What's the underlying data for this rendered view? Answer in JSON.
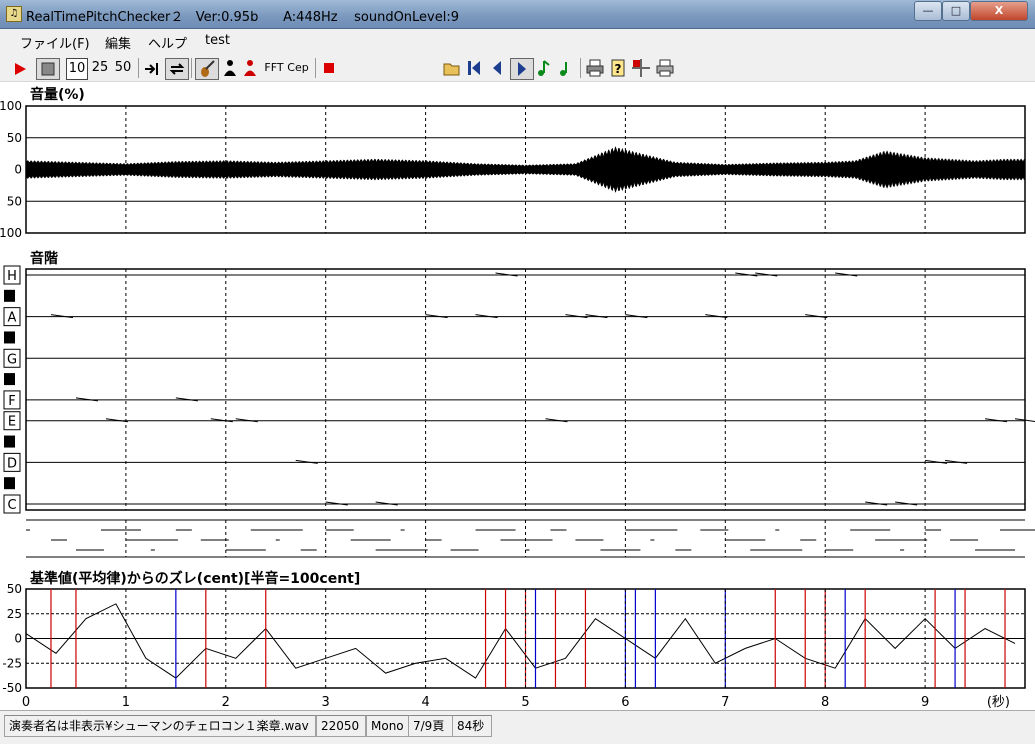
{
  "window": {
    "title": "RealTimePitchChecker２   Ver:0.95b      A:448Hz    soundOnLevel:9",
    "minimize_label": "—",
    "maximize_label": "□",
    "close_label": "X"
  },
  "menu": {
    "items": [
      "ファイル(F)",
      "編集",
      "ヘルプ",
      "test"
    ]
  },
  "toolbar": {
    "speed_options": [
      "10",
      "25",
      "50"
    ],
    "fft_label": "FFT",
    "cep_label": "Cep",
    "note_display": "＊＊＊"
  },
  "volume_panel": {
    "title": "音量(%)",
    "y_labels": [
      "100",
      "50",
      "0",
      "50",
      "100"
    ]
  },
  "scale_panel": {
    "title": "音階",
    "note_labels": [
      "H",
      "A",
      "G",
      "F",
      "E",
      "D",
      "C"
    ]
  },
  "deviation_panel": {
    "title": "基準値(平均律)からのズレ(cent)[半音=100cent]",
    "y_labels": [
      "50",
      "25",
      "0",
      "-25",
      "-50"
    ]
  },
  "time_axis": {
    "labels": [
      "0",
      "1",
      "2",
      "3",
      "4",
      "5",
      "6",
      "7",
      "8",
      "9"
    ],
    "unit": "(秒)"
  },
  "statusbar": {
    "file": "演奏者名は非表示¥シューマンのチェロコン１楽章.wav",
    "rate": "22050",
    "channels": "Mono",
    "page": "7/9頁",
    "duration": "84秒"
  },
  "chart_data": [
    {
      "type": "area",
      "title": "音量(%)",
      "x": [
        0,
        0.5,
        1,
        1.5,
        2,
        2.5,
        3,
        3.5,
        4,
        4.5,
        5,
        5.5,
        5.9,
        6.2,
        6.5,
        7,
        7.5,
        8,
        8.3,
        8.6,
        9,
        9.5,
        9.8
      ],
      "values": [
        12,
        10,
        8,
        11,
        12,
        10,
        12,
        14,
        12,
        8,
        6,
        8,
        30,
        20,
        10,
        7,
        9,
        10,
        12,
        25,
        16,
        12,
        14
      ],
      "xlim": [
        0,
        10
      ],
      "ylim": [
        -100,
        100
      ]
    },
    {
      "type": "line",
      "title": "音階",
      "y_categories": [
        "C",
        "D",
        "E",
        "F",
        "G",
        "A",
        "H"
      ],
      "x": [
        0.25,
        0.5,
        0.8,
        1.5,
        1.85,
        2.1,
        2.7,
        3.0,
        3.5,
        4.0,
        4.5,
        4.7,
        5.2,
        5.4,
        5.6,
        6.0,
        6.8,
        7.1,
        7.3,
        7.8,
        8.1,
        8.4,
        8.7,
        9.0,
        9.2,
        9.6,
        9.9
      ],
      "values": [
        "A",
        "F",
        "E",
        "F",
        "E",
        "E",
        "D",
        "C",
        "C",
        "A",
        "A",
        "H",
        "E",
        "A",
        "A",
        "A",
        "A",
        "H",
        "H",
        "A",
        "H",
        "C",
        "C",
        "D",
        "D",
        "E",
        "E"
      ],
      "xlim": [
        0,
        10
      ]
    },
    {
      "type": "line",
      "title": "基準値(平均律)からのズレ(cent)[半音=100cent]",
      "x": [
        0,
        0.3,
        0.6,
        0.9,
        1.2,
        1.5,
        1.8,
        2.1,
        2.4,
        2.7,
        3.0,
        3.3,
        3.6,
        3.9,
        4.2,
        4.5,
        4.8,
        5.1,
        5.4,
        5.7,
        6.0,
        6.3,
        6.6,
        6.9,
        7.2,
        7.5,
        7.8,
        8.1,
        8.4,
        8.7,
        9.0,
        9.3,
        9.6,
        9.9
      ],
      "values": [
        5,
        -15,
        20,
        35,
        -20,
        -40,
        -10,
        -20,
        10,
        -30,
        -20,
        -10,
        -35,
        -25,
        -20,
        -40,
        10,
        -30,
        -20,
        20,
        0,
        -20,
        20,
        -25,
        -10,
        0,
        -20,
        -30,
        20,
        -10,
        20,
        -10,
        10,
        -5
      ],
      "xlim": [
        0,
        10
      ],
      "ylim": [
        -50,
        50
      ]
    }
  ]
}
